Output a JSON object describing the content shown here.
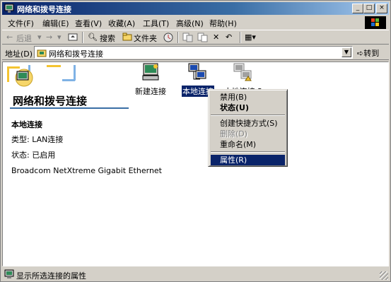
{
  "window": {
    "title": "网络和拨号连接",
    "controls": {
      "minimize": "_",
      "maximize": "□",
      "close": "×"
    }
  },
  "menubar": {
    "items": [
      "文件(F)",
      "编辑(E)",
      "查看(V)",
      "收藏(A)",
      "工具(T)",
      "高级(N)",
      "帮助(H)"
    ]
  },
  "toolbar": {
    "back": "后退",
    "forward": "→",
    "search": "搜索",
    "folders": "文件夹",
    "history_icon": "history-icon",
    "move_icon": "move-to-icon",
    "copy_icon": "copy-to-icon",
    "delete": "✕",
    "undo": "↶",
    "views": "▦▾"
  },
  "addressbar": {
    "label": "地址(D)",
    "value": "网络和拨号连接",
    "go": "转到"
  },
  "leftpane": {
    "folder_title": "网络和拨号连接",
    "selected_name": "本地连接",
    "type": "类型: LAN连接",
    "status": "状态: 已启用",
    "device": "Broadcom NetXtreme Gigabit Ethernet"
  },
  "icons": [
    {
      "label": "新建连接",
      "selected": false
    },
    {
      "label": "本地连接",
      "selected": true
    },
    {
      "label": "本地连接 2",
      "selected": false
    }
  ],
  "context_menu": {
    "disable": "禁用(B)",
    "status": "状态(U)",
    "create_shortcut": "创建快捷方式(S)",
    "delete": "删除(D)",
    "rename": "重命名(M)",
    "properties": "属性(R)"
  },
  "statusbar": {
    "text": "显示所选连接的属性"
  },
  "colors": {
    "titlebar": "#0a246a",
    "selection": "#0a246a",
    "face": "#d4d0c8"
  }
}
